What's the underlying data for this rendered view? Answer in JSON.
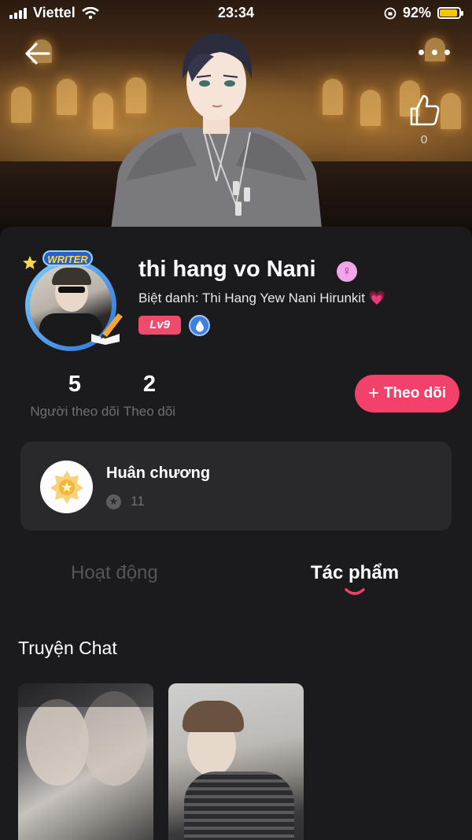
{
  "status_bar": {
    "carrier": "Viettel",
    "time": "23:34",
    "battery_percent": "92%",
    "battery_level": 0.92
  },
  "header": {
    "like_count": "0"
  },
  "profile": {
    "avatar_badge": "WRITER",
    "name": "thi hang vo Nani",
    "nickname": "Biệt danh: Thi Hang Yew Nani Hirunkit 💗",
    "level": "Lv9",
    "followers_count": "5",
    "followers_label": "Người theo dõi",
    "following_count": "2",
    "following_label": "Theo dõi",
    "follow_button_label": "Theo dõi"
  },
  "medals": {
    "title": "Huân chương",
    "count": "11"
  },
  "tabs": [
    {
      "label": "Hoạt động",
      "active": false
    },
    {
      "label": "Tác phẩm",
      "active": true
    }
  ],
  "section": {
    "title": "Truyện Chat"
  },
  "colors": {
    "accent": "#f2416b",
    "background": "#1b1b1d",
    "card": "#29292c",
    "muted_text": "#6f6f73",
    "level_badge": "#f04a6c"
  },
  "icons": [
    "back-arrow-icon",
    "more-dots-icon",
    "thumbs-up-icon",
    "gender-female-icon",
    "verified-droplet-icon",
    "plus-icon",
    "medal-icon",
    "star-mini-icon",
    "wifi-icon",
    "signal-icon",
    "battery-icon",
    "orientation-lock-icon"
  ]
}
